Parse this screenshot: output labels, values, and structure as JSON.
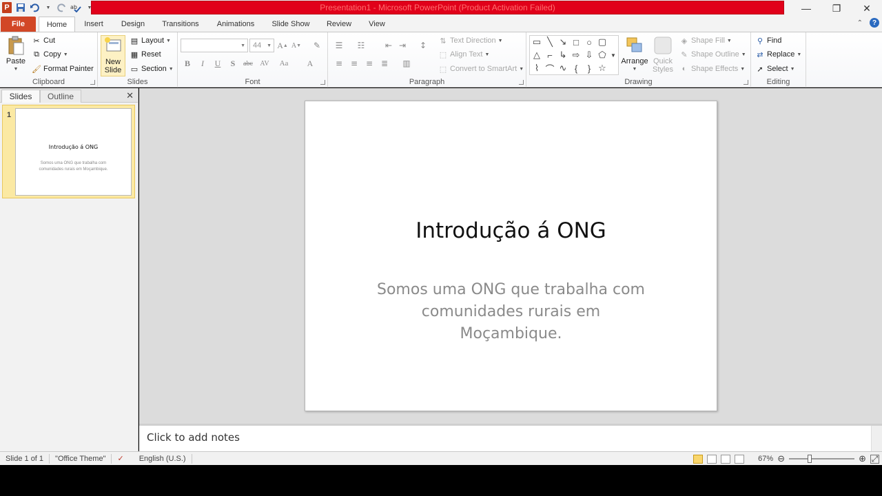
{
  "window": {
    "title": "Presentation1 - Microsoft PowerPoint (Product Activation Failed)"
  },
  "tabs": [
    "File",
    "Home",
    "Insert",
    "Design",
    "Transitions",
    "Animations",
    "Slide Show",
    "Review",
    "View"
  ],
  "ribbon": {
    "clipboard": {
      "paste": "Paste",
      "cut": "Cut",
      "copy": "Copy",
      "format_painter": "Format Painter",
      "label": "Clipboard"
    },
    "slides": {
      "new_slide_line1": "New",
      "new_slide_line2": "Slide",
      "layout": "Layout",
      "reset": "Reset",
      "section": "Section",
      "label": "Slides"
    },
    "font": {
      "size": "44",
      "label": "Font"
    },
    "paragraph": {
      "text_direction": "Text Direction",
      "align_text": "Align Text",
      "convert_smartart": "Convert to SmartArt",
      "label": "Paragraph"
    },
    "drawing": {
      "arrange": "Arrange",
      "quick_styles_line1": "Quick",
      "quick_styles_line2": "Styles",
      "shape_fill": "Shape Fill",
      "shape_outline": "Shape Outline",
      "shape_effects": "Shape Effects",
      "label": "Drawing"
    },
    "editing": {
      "find": "Find",
      "replace": "Replace",
      "select": "Select",
      "label": "Editing"
    }
  },
  "left_pane": {
    "tabs": [
      "Slides",
      "Outline"
    ],
    "thumbnails": [
      {
        "number": "1",
        "title": "Introdução á ONG",
        "body": "Somos uma ONG que trabalha com comunidades rurais em Moçambique."
      }
    ]
  },
  "slide": {
    "title": "Introdução á ONG",
    "subtitle": "Somos uma ONG que trabalha com comunidades rurais em Moçambique."
  },
  "notes": {
    "placeholder": "Click to add notes"
  },
  "status": {
    "slide_info": "Slide 1 of 1",
    "theme": "\"Office Theme\"",
    "language": "English (U.S.)",
    "zoom": "67%"
  },
  "colors": {
    "file_tab": "#d24726",
    "title_bar_banner": "#e1001a",
    "selected_thumbnail": "#fbe9a3"
  }
}
